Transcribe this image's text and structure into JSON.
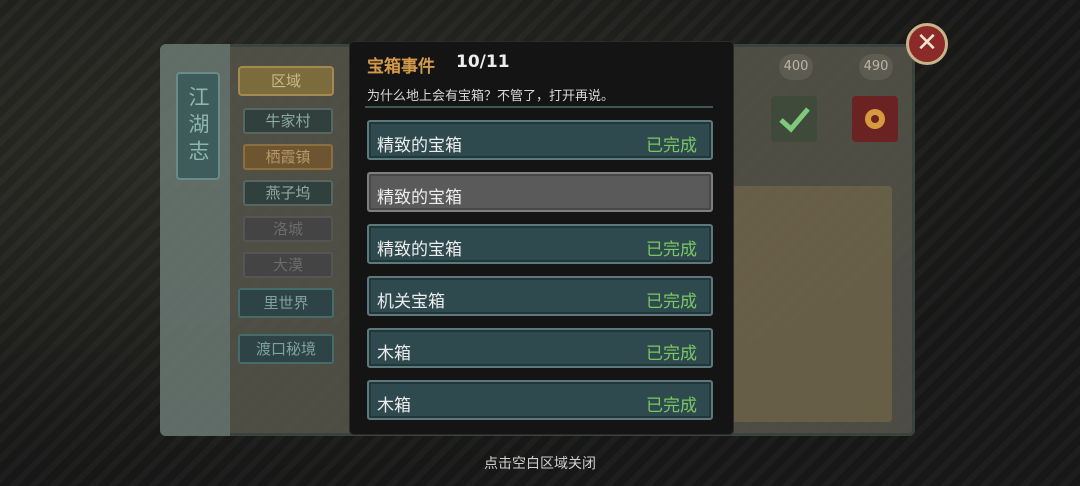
{
  "background": {
    "journal_title": "江湖志",
    "region_header": "区域",
    "regions": [
      {
        "label": "牛家村"
      },
      {
        "label": "栖霞镇"
      },
      {
        "label": "燕子坞"
      },
      {
        "label": "洛城"
      },
      {
        "label": "大漠"
      }
    ],
    "extra_regions": [
      {
        "label": "里世界"
      },
      {
        "label": "渡口秘境"
      }
    ],
    "badges": [
      "400",
      "490"
    ]
  },
  "modal": {
    "title": "宝箱事件",
    "count": "10/11",
    "description": "为什么地上会有宝箱？不管了，打开再说。",
    "chests": [
      {
        "name": "精致的宝箱",
        "status": "已完成",
        "completed": true
      },
      {
        "name": "精致的宝箱",
        "status": "",
        "completed": false
      },
      {
        "name": "精致的宝箱",
        "status": "已完成",
        "completed": true
      },
      {
        "name": "机关宝箱",
        "status": "已完成",
        "completed": true
      },
      {
        "name": "木箱",
        "status": "已完成",
        "completed": true
      },
      {
        "name": "木箱",
        "status": "已完成",
        "completed": true
      }
    ]
  },
  "close_hint": "点击空白区域关闭",
  "colors": {
    "accent": "#d39a4b",
    "completed": "#79c862",
    "row_bg": "#2f4a4f",
    "pending_bg": "#5a5a5a"
  },
  "icons": {
    "close": "close-icon"
  }
}
